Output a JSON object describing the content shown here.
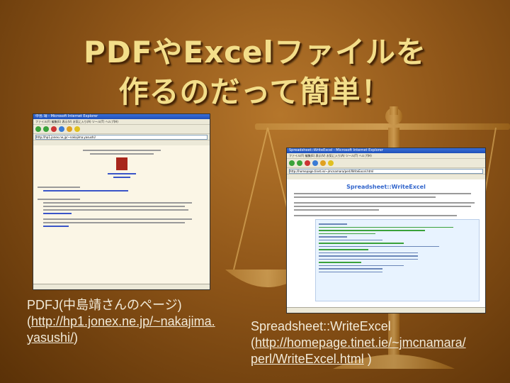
{
  "slide": {
    "title_line1": "PDFやExcelファイルを",
    "title_line2": "作るのだって簡単！"
  },
  "screenshot1": {
    "window_title": "中島 靖 - Microsoft Internet Explorer",
    "menu": "ファイル(F)  編集(E)  表示(V)  お気に入り(A)  ツール(T)  ヘルプ(H)",
    "address": "http://hp1.jonex.ne.jp/~nakajima.yasushi/"
  },
  "screenshot2": {
    "window_title": "Spreadsheet::WriteExcel - Microsoft Internet Explorer",
    "menu": "ファイル(F)  編集(E)  表示(V)  お気に入り(A)  ツール(T)  ヘルプ(H)",
    "address": "http://homepage.tinet.ie/~jmcnamara/perl/WriteExcel.html",
    "heading": "Spreadsheet::WriteExcel"
  },
  "caption1": {
    "line1": "PDFJ(中島靖さんのページ)",
    "open_paren": "(",
    "url_part1": "http://hp1.jonex.ne.jp/~nakajima.",
    "url_part2": "yasushi/",
    "close_paren": ")"
  },
  "caption2": {
    "line1": "Spreadsheet::WriteExcel",
    "open_paren": "(",
    "url_part1": "http://homepage.tinet.ie/~jmcnamara/",
    "url_part2": "perl/WriteExcel.html",
    "close_paren": " )"
  }
}
